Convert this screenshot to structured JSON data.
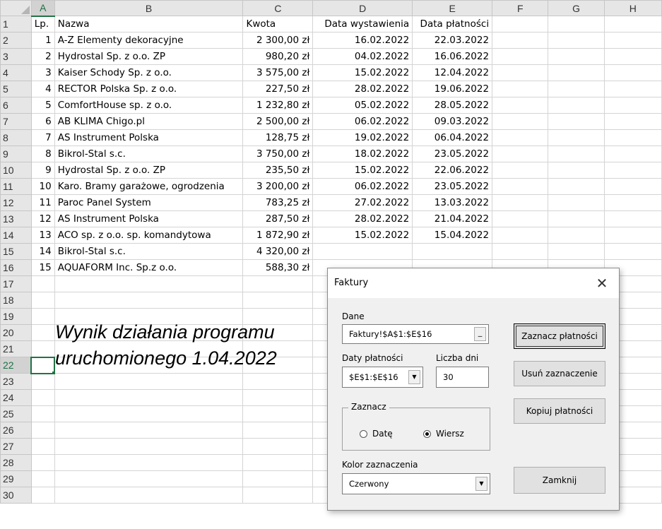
{
  "columns": [
    "A",
    "B",
    "C",
    "D",
    "E",
    "F",
    "G",
    "H"
  ],
  "rows": [
    {
      "num": "1",
      "lp": "Lp.",
      "name": "Nazwa",
      "amount": "Kwota",
      "issued": "Data wystawienia",
      "due": "Data płatności",
      "hl": false,
      "header": true
    },
    {
      "num": "2",
      "lp": "1",
      "name": "A-Z Elementy dekoracyjne",
      "amount": "2 300,00 zł",
      "issued": "16.02.2022",
      "due": "22.03.2022",
      "hl": false
    },
    {
      "num": "3",
      "lp": "2",
      "name": "Hydrostal Sp. z o.o. ZP",
      "amount": "980,20 zł",
      "issued": "04.02.2022",
      "due": "16.06.2022",
      "hl": false
    },
    {
      "num": "4",
      "lp": "3",
      "name": "Kaiser Schody Sp. z o.o.",
      "amount": "3 575,00 zł",
      "issued": "15.02.2022",
      "due": "12.04.2022",
      "hl": true
    },
    {
      "num": "5",
      "lp": "4",
      "name": "RECTOR Polska Sp. z o.o.",
      "amount": "227,50 zł",
      "issued": "28.02.2022",
      "due": "19.06.2022",
      "hl": false
    },
    {
      "num": "6",
      "lp": "5",
      "name": "ComfortHouse sp. z o.o.",
      "amount": "1 232,80 zł",
      "issued": "05.02.2022",
      "due": "28.05.2022",
      "hl": false
    },
    {
      "num": "7",
      "lp": "6",
      "name": "AB KLIMA Chigo.pl",
      "amount": "2 500,00 zł",
      "issued": "06.02.2022",
      "due": "09.03.2022",
      "hl": false
    },
    {
      "num": "8",
      "lp": "7",
      "name": "AS Instrument Polska",
      "amount": "128,75 zł",
      "issued": "19.02.2022",
      "due": "06.04.2022",
      "hl": true
    },
    {
      "num": "9",
      "lp": "8",
      "name": "Bikrol-Stal s.c.",
      "amount": "3 750,00 zł",
      "issued": "18.02.2022",
      "due": "23.05.2022",
      "hl": false
    },
    {
      "num": "10",
      "lp": "9",
      "name": "Hydrostal Sp. z o.o. ZP",
      "amount": "235,50 zł",
      "issued": "15.02.2022",
      "due": "22.06.2022",
      "hl": false
    },
    {
      "num": "11",
      "lp": "10",
      "name": "Karo. Bramy garażowe, ogrodzenia",
      "amount": "3 200,00 zł",
      "issued": "06.02.2022",
      "due": "23.05.2022",
      "hl": false
    },
    {
      "num": "12",
      "lp": "11",
      "name": "Paroc Panel System",
      "amount": "783,25 zł",
      "issued": "27.02.2022",
      "due": "13.03.2022",
      "hl": false
    },
    {
      "num": "13",
      "lp": "12",
      "name": "AS Instrument Polska",
      "amount": "287,50 zł",
      "issued": "28.02.2022",
      "due": "21.04.2022",
      "hl": true
    },
    {
      "num": "14",
      "lp": "13",
      "name": "ACO sp. z o.o. sp. komandytowa",
      "amount": "1 872,90 zł",
      "issued": "15.02.2022",
      "due": "15.04.2022",
      "hl": true
    },
    {
      "num": "15",
      "lp": "14",
      "name": "Bikrol-Stal s.c.",
      "amount": "4 320,00 zł",
      "issued": "",
      "due": "",
      "hl": false
    },
    {
      "num": "16",
      "lp": "15",
      "name": "AQUAFORM Inc. Sp.z o.o.",
      "amount": "588,30 zł",
      "issued": "",
      "due": "",
      "hl": false
    },
    {
      "num": "17"
    },
    {
      "num": "18"
    },
    {
      "num": "19"
    },
    {
      "num": "20"
    },
    {
      "num": "21"
    },
    {
      "num": "22",
      "active": true
    },
    {
      "num": "23"
    },
    {
      "num": "24"
    },
    {
      "num": "25"
    },
    {
      "num": "26"
    },
    {
      "num": "27"
    },
    {
      "num": "28"
    },
    {
      "num": "29"
    },
    {
      "num": "30"
    }
  ],
  "note": {
    "line1": "Wynik działania programu",
    "line2": "uruchomionego 1.04.2022"
  },
  "dialog": {
    "title": "Faktury",
    "close": "✕",
    "dane_label": "Dane",
    "dane_value": "Faktury!$A$1:$E$16",
    "dane_btn": "_",
    "daty_label": "Daty płatności",
    "daty_value": "$E$1:$E$16",
    "liczba_label": "Liczba dni",
    "liczba_value": "30",
    "zaznacz_legend": "Zaznacz",
    "radio_date": "Datę",
    "radio_row": "Wiersz",
    "kolor_label": "Kolor zaznaczenia",
    "kolor_value": "Czerwony",
    "btn_mark": "Zaznacz płatności",
    "btn_clear": "Usuń zaznaczenie",
    "btn_copy": "Kopiuj płatności",
    "btn_close": "Zamknij"
  }
}
